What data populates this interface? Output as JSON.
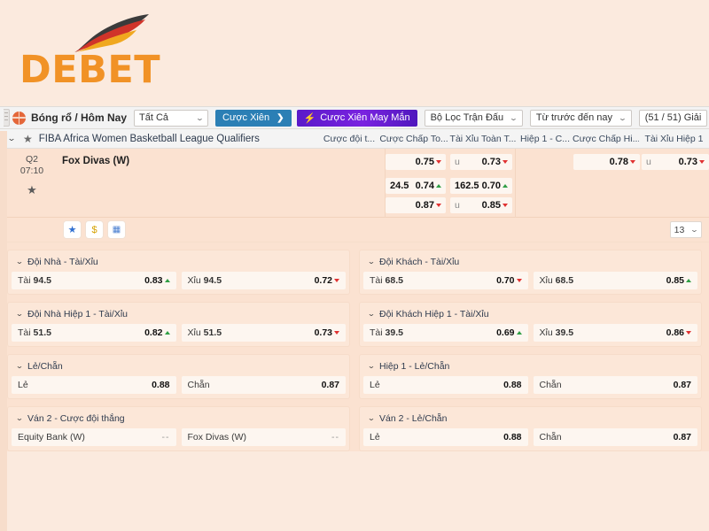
{
  "brand": {
    "name": "DEBET"
  },
  "toolbar": {
    "sport_title": "Bóng rổ / Hôm Nay",
    "all_filter": "Tất Cả",
    "parlay_button": "Cược Xiên",
    "parlay_arrow": "❯",
    "lucky_parlay_button": "Cược Xiên May Mắn",
    "lucky_bolt": "⚡",
    "match_filter": "Bộ Lọc Trận Đấu",
    "time_filter": "Từ trước đến nay",
    "league_count": "(51 / 51) Giải",
    "chevron": "⌄"
  },
  "league": {
    "name": "FIBA Africa Women Basketball League Qualifiers",
    "chevron": "⌄",
    "star": "★",
    "columns": [
      "Cược đội t...",
      "Cược Chấp To...",
      "Tài Xỉu Toàn T...",
      "Hiệp 1 - C...",
      "Cược Chấp Hi...",
      "Tài Xỉu Hiệp 1"
    ]
  },
  "match": {
    "period": "Q2",
    "clock": "07:10",
    "star": "★",
    "team": "Fox Divas (W)",
    "odds": {
      "row1": [
        {
          "col": "handicap_full",
          "handicap": "",
          "side": "",
          "value": "0.75",
          "dir": "down"
        },
        {
          "col": "ou_full",
          "handicap": "",
          "side": "u",
          "value": "0.73",
          "dir": "down"
        },
        {
          "col": "handicap_h1",
          "handicap": "",
          "side": "",
          "value": "0.78",
          "dir": "down"
        },
        {
          "col": "ou_h1",
          "handicap": "",
          "side": "u",
          "value": "0.73",
          "dir": "down"
        }
      ],
      "row2": [
        {
          "col": "handicap_full",
          "handicap": "24.5",
          "side": "",
          "value": "0.74",
          "dir": "up"
        },
        {
          "col": "ou_full",
          "handicap": "162.5",
          "side": "",
          "value": "0.70",
          "dir": "up"
        }
      ],
      "row3": [
        {
          "col": "handicap_full",
          "handicap": "",
          "side": "",
          "value": "0.87",
          "dir": "down"
        },
        {
          "col": "ou_full",
          "handicap": "",
          "side": "u",
          "value": "0.85",
          "dir": "down"
        }
      ]
    }
  },
  "action_strip": {
    "favorite_icon": "★",
    "cashout_icon": "$",
    "stats_icon": "▦",
    "count_value": "13",
    "count_chevron": "⌄"
  },
  "markets": [
    {
      "title": "Đội Nhà - Tài/Xỉu",
      "options": [
        {
          "label": "Tài",
          "line": "94.5",
          "value": "0.83",
          "dir": "up"
        },
        {
          "label": "Xỉu",
          "line": "94.5",
          "value": "0.72",
          "dir": "down"
        }
      ]
    },
    {
      "title": "Đội Khách - Tài/Xỉu",
      "options": [
        {
          "label": "Tài",
          "line": "68.5",
          "value": "0.70",
          "dir": "down"
        },
        {
          "label": "Xỉu",
          "line": "68.5",
          "value": "0.85",
          "dir": "up"
        }
      ]
    },
    {
      "title": "Đội Nhà Hiệp 1 - Tài/Xỉu",
      "options": [
        {
          "label": "Tài",
          "line": "51.5",
          "value": "0.82",
          "dir": "up"
        },
        {
          "label": "Xỉu",
          "line": "51.5",
          "value": "0.73",
          "dir": "down"
        }
      ]
    },
    {
      "title": "Đội Khách Hiệp 1 - Tài/Xỉu",
      "options": [
        {
          "label": "Tài",
          "line": "39.5",
          "value": "0.69",
          "dir": "up"
        },
        {
          "label": "Xỉu",
          "line": "39.5",
          "value": "0.86",
          "dir": "down"
        }
      ]
    },
    {
      "title": "Lẻ/Chẵn",
      "options": [
        {
          "label": "Lẻ",
          "line": "",
          "value": "0.88",
          "dir": "none"
        },
        {
          "label": "Chẵn",
          "line": "",
          "value": "0.87",
          "dir": "none"
        }
      ]
    },
    {
      "title": "Hiệp 1 - Lẻ/Chẵn",
      "options": [
        {
          "label": "Lẻ",
          "line": "",
          "value": "0.88",
          "dir": "none"
        },
        {
          "label": "Chẵn",
          "line": "",
          "value": "0.87",
          "dir": "none"
        }
      ]
    },
    {
      "title": "Ván 2 - Cược đội thắng",
      "options": [
        {
          "label": "Equity Bank (W)",
          "line": "",
          "value": "--",
          "dir": "none"
        },
        {
          "label": "Fox Divas (W)",
          "line": "",
          "value": "--",
          "dir": "none"
        }
      ]
    },
    {
      "title": "Ván 2 - Lẻ/Chẵn",
      "options": [
        {
          "label": "Lẻ",
          "line": "",
          "value": "0.88",
          "dir": "none"
        },
        {
          "label": "Chẵn",
          "line": "",
          "value": "0.87",
          "dir": "none"
        }
      ]
    }
  ],
  "colors": {
    "page_bg": "#fbeade",
    "brand_orange": "#f19226",
    "parlay_blue": "#2b7fb5",
    "lucky_purple": "#6a1fd4",
    "up_green": "#2f9e44",
    "down_red": "#e03131",
    "row_peach": "#fbe2d1",
    "cell_cream": "#fdf6f0"
  }
}
